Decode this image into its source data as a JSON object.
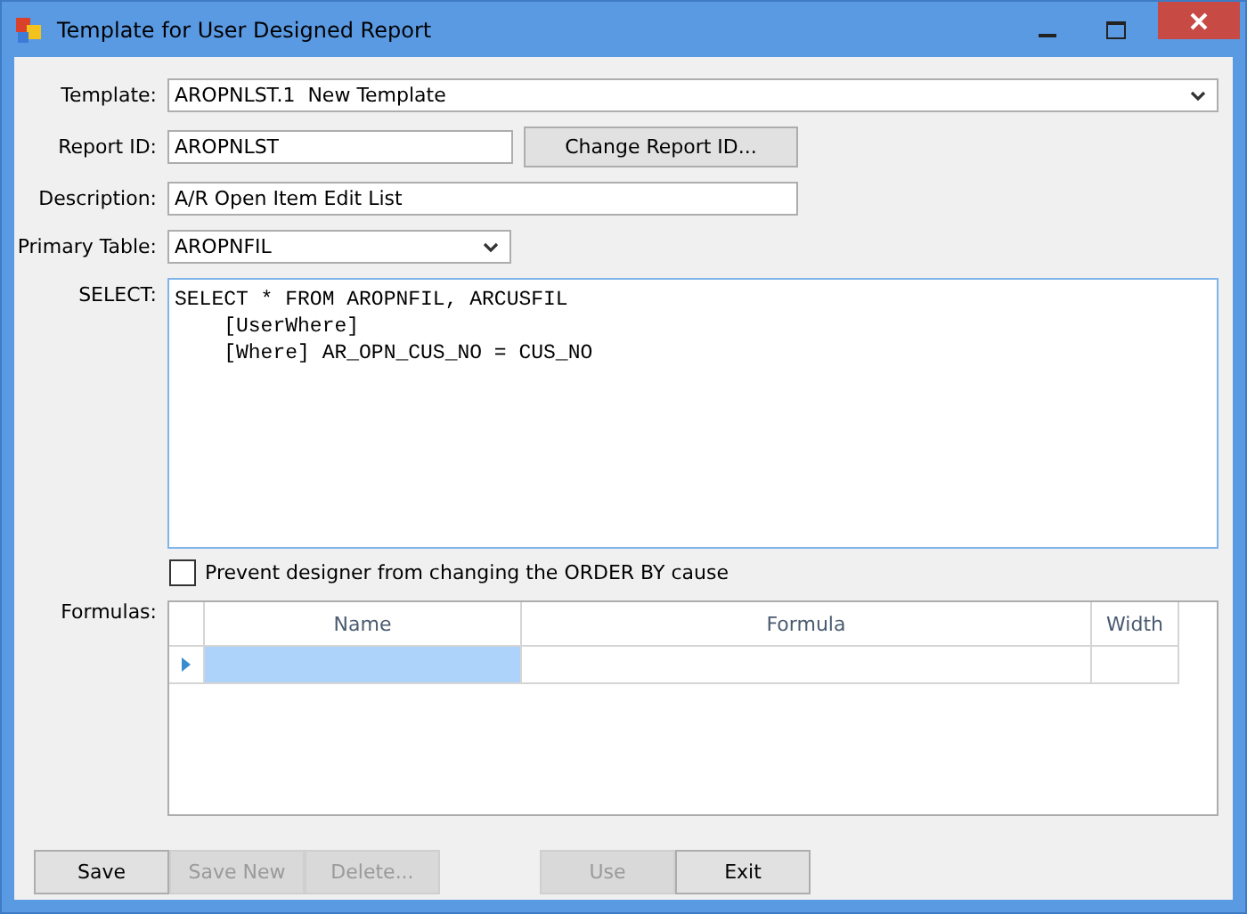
{
  "window": {
    "title": "Template for User Designed Report"
  },
  "fields": {
    "template": {
      "label": "Template:",
      "value": "AROPNLST.1  New Template"
    },
    "report_id": {
      "label": "Report ID:",
      "value": "AROPNLST",
      "button": "Change Report ID..."
    },
    "description": {
      "label": "Description:",
      "value": "A/R Open Item Edit List"
    },
    "primary_table": {
      "label": "Primary Table:",
      "value": "AROPNFIL"
    },
    "select": {
      "label": "SELECT:",
      "lines": [
        "SELECT * FROM AROPNFIL, ARCUSFIL",
        "    [UserWhere]",
        "    [Where] AR_OPN_CUS_NO = CUS_NO"
      ]
    }
  },
  "prevent_checkbox": {
    "label": "Prevent designer from changing the ORDER BY cause",
    "checked": false
  },
  "formulas": {
    "label": "Formulas:",
    "columns": [
      "Name",
      "Formula",
      "Width"
    ],
    "rows": [
      {
        "current": true,
        "selected": true
      }
    ]
  },
  "buttons_left": [
    {
      "label": "Save",
      "disabled": false
    },
    {
      "label": "Save New",
      "disabled": true
    },
    {
      "label": "Delete...",
      "disabled": true
    }
  ],
  "buttons_right": [
    {
      "label": "Use",
      "disabled": true
    },
    {
      "label": "Exit",
      "disabled": false
    }
  ]
}
